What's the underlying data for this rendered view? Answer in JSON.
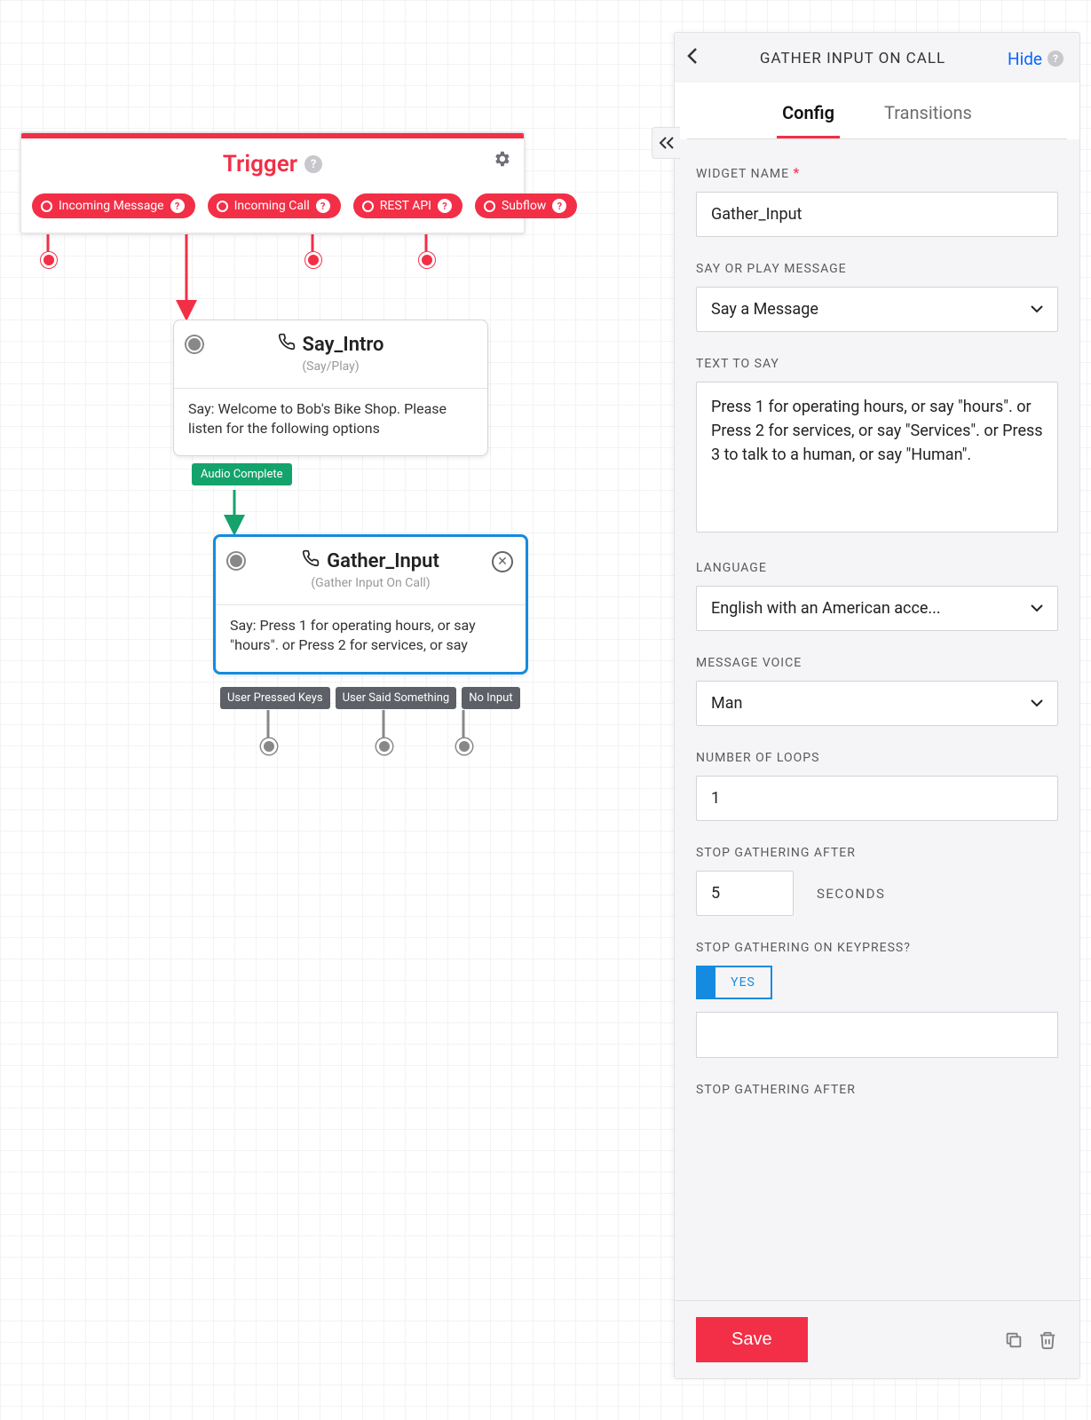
{
  "trigger": {
    "title": "Trigger",
    "pills": [
      {
        "label": "Incoming Message"
      },
      {
        "label": "Incoming Call"
      },
      {
        "label": "REST API"
      },
      {
        "label": "Subflow"
      }
    ]
  },
  "nodes": {
    "say_intro": {
      "title": "Say_Intro",
      "subtitle": "(Say/Play)",
      "body": "Say: Welcome to Bob's Bike Shop. Please listen for the following options",
      "out_label": "Audio Complete"
    },
    "gather_input": {
      "title": "Gather_Input",
      "subtitle": "(Gather Input On Call)",
      "body": "Say: Press 1 for operating hours, or say \"hours\". or Press 2 for services, or say",
      "outs": [
        "User Pressed Keys",
        "User Said Something",
        "No Input"
      ]
    }
  },
  "panel": {
    "title": "GATHER INPUT ON CALL",
    "hide": "Hide",
    "tabs": {
      "config": "Config",
      "transitions": "Transitions"
    },
    "fields": {
      "widget_name_label": "WIDGET NAME",
      "widget_name_value": "Gather_Input",
      "say_or_play_label": "SAY OR PLAY MESSAGE",
      "say_or_play_value": "Say a Message",
      "text_to_say_label": "TEXT TO SAY",
      "text_to_say_value": "Press 1 for operating hours, or say \"hours\". or Press 2 for services, or say \"Services\". or Press 3 to talk to a human, or say \"Human\".",
      "language_label": "LANGUAGE",
      "language_value": "English with an American acce...",
      "voice_label": "MESSAGE VOICE",
      "voice_value": "Man",
      "loops_label": "NUMBER OF LOOPS",
      "loops_value": "1",
      "stop_after_label": "STOP GATHERING AFTER",
      "stop_after_value": "5",
      "seconds": "SECONDS",
      "stop_keypress_label": "STOP GATHERING ON KEYPRESS?",
      "toggle_yes": "YES",
      "stop_after2_label": "STOP GATHERING AFTER"
    },
    "save": "Save"
  }
}
